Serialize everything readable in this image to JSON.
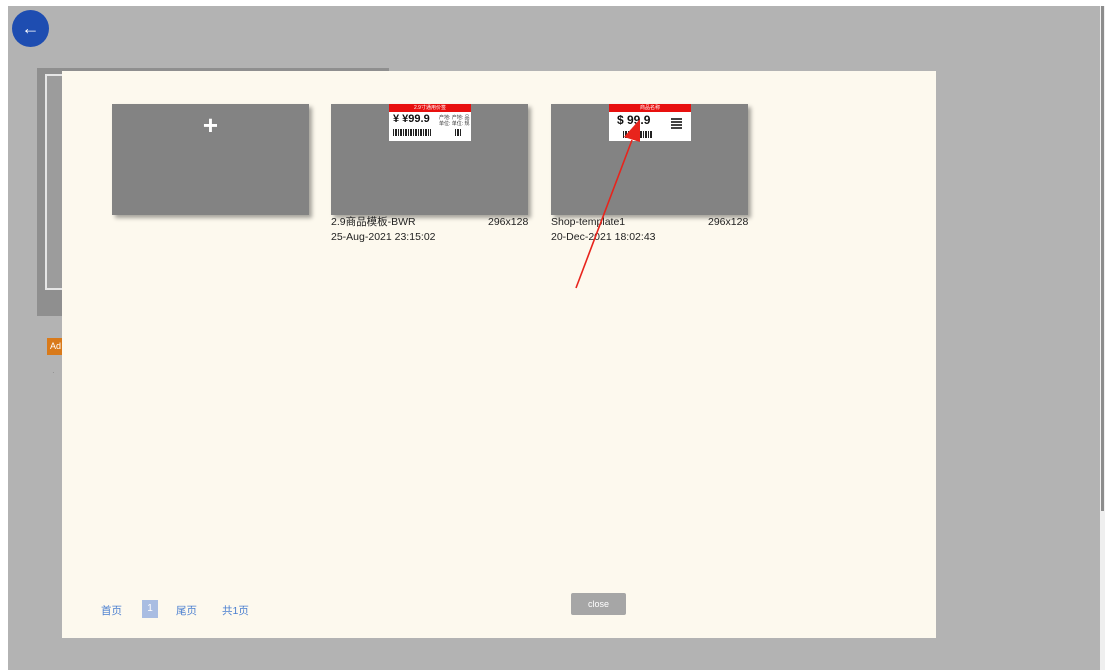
{
  "back_button": {
    "icon": "arrow-left-icon",
    "glyph": "←"
  },
  "background": {
    "badge_text": "Ad"
  },
  "templates": [
    {
      "type": "add",
      "glyph": "+"
    },
    {
      "name": "2.9商品模板-BWR",
      "size": "296x128",
      "date": "25-Aug-2021 23:15:02",
      "preview": {
        "header": "2.9寸通用价签",
        "price": "¥ ¥99.9",
        "fine_1": "产地: 产地: 品",
        "fine_2": "单位: 单位: 规"
      }
    },
    {
      "name": "Shop-template1",
      "size": "296x128",
      "date": "20-Dec-2021 18:02:43",
      "preview": {
        "header": "商品名称",
        "price": "$ 99.9"
      }
    }
  ],
  "pagination": {
    "first": "首页",
    "current": "1",
    "last": "尾页",
    "total": "共1页"
  },
  "close_label": "close",
  "colors": {
    "label_header": "#e8100e",
    "annotation_arrow": "#e8241c",
    "modal_bg": "#fdf9ee",
    "back_button": "#1e4db1"
  }
}
